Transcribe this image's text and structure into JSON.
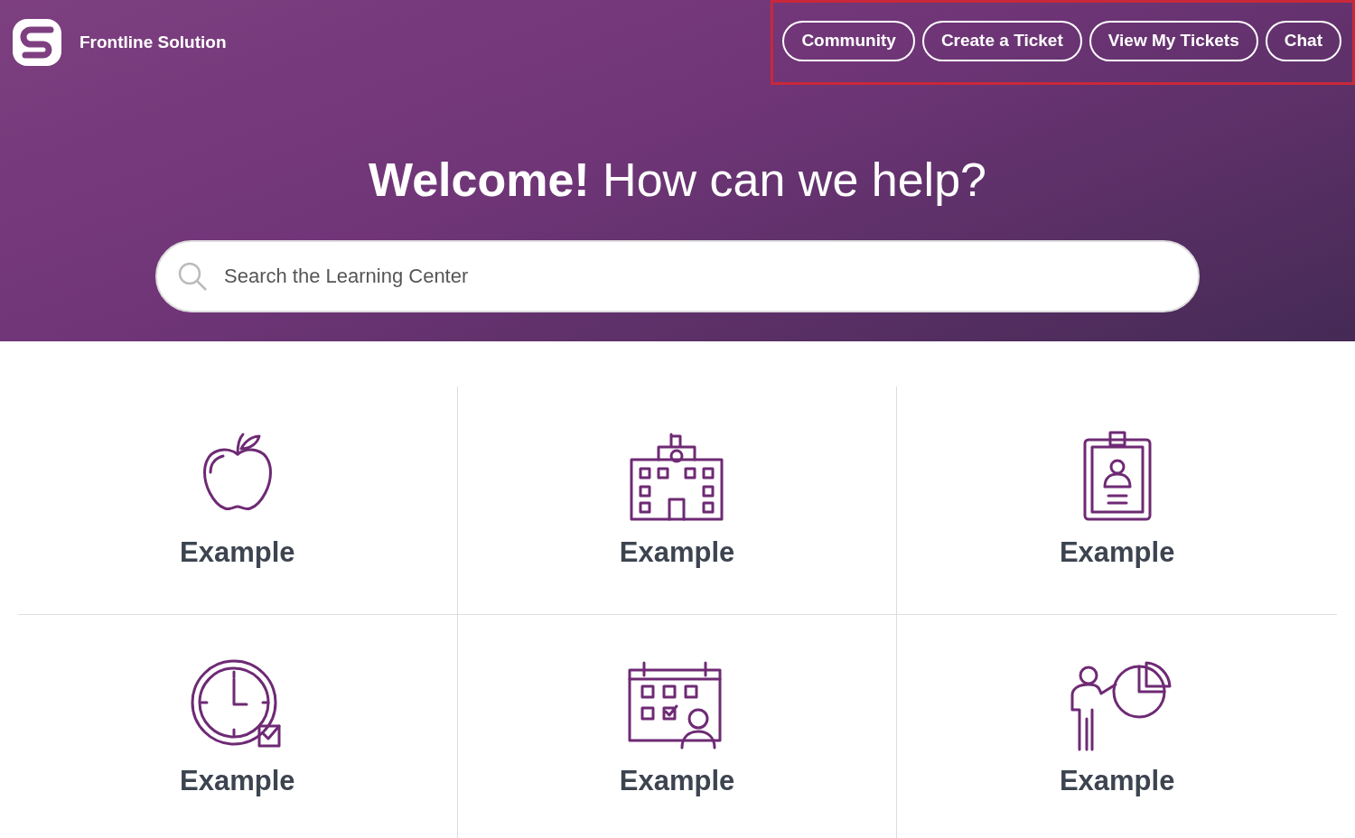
{
  "brand": {
    "name": "Frontline Solution"
  },
  "nav": {
    "highlighted": true,
    "buttons": [
      "Community",
      "Create a Ticket",
      "View My Tickets",
      "Chat"
    ]
  },
  "hero": {
    "heading": "**Welcome!** How can we help?",
    "search": {
      "placeholder": "Search the Learning Center"
    }
  },
  "tiles": [
    {
      "label": "Example"
    },
    {
      "label": "Example"
    },
    {
      "label": "Example"
    },
    {
      "label": "Example"
    },
    {
      "label": "Example"
    },
    {
      "label": "Example"
    }
  ]
}
